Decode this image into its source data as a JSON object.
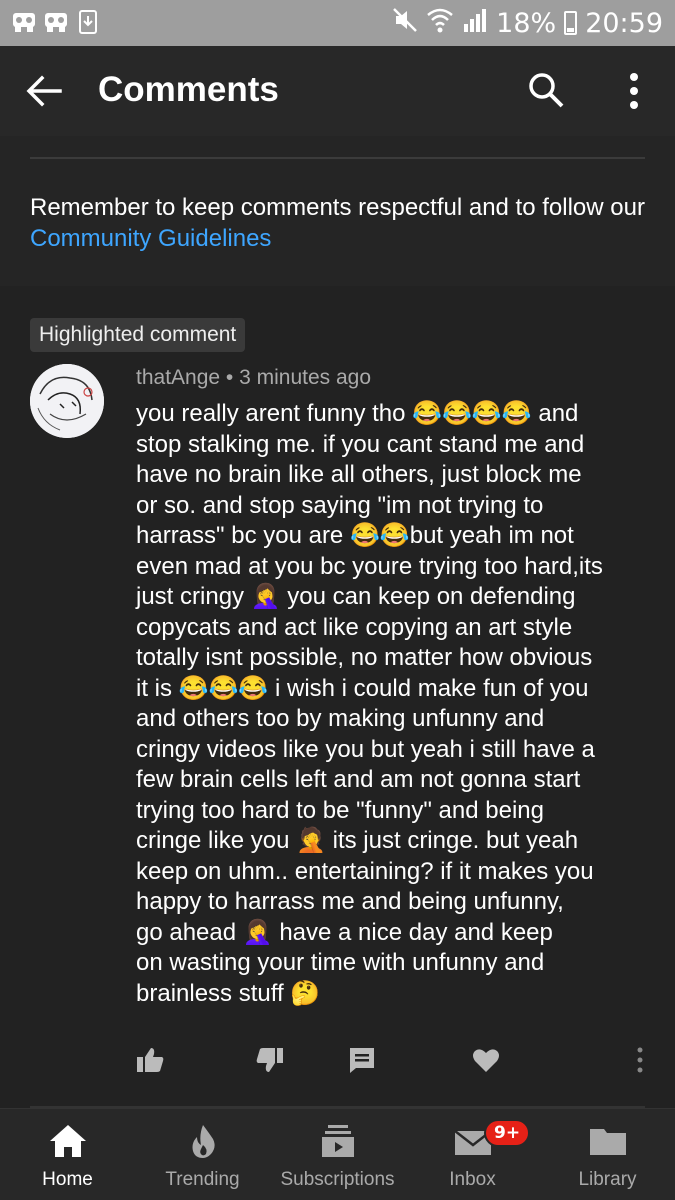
{
  "status_bar": {
    "battery": "18%",
    "time": "20:59",
    "icons": [
      "app-icon",
      "app-icon",
      "download-icon",
      "mute-icon",
      "wifi-icon",
      "signal-icon",
      "battery-icon"
    ]
  },
  "header": {
    "title": "Comments"
  },
  "reminder": {
    "text": "Remember to keep comments respectful and to follow our ",
    "link": "Community Guidelines"
  },
  "comment": {
    "badge": "Highlighted comment",
    "author": "thatAnge",
    "time": " • 3 minutes ago",
    "text": "you really arent funny tho 😂😂😂😂 and\nstop stalking me. if you cant stand me and\nhave no brain like all others, just block me\nor so. and stop saying \"im not trying to\nharrass\" bc you are 😂😂but yeah im not\neven mad at you bc youre trying too hard,its\njust cringy 🤦‍♀️ you can keep on defending\ncopycats and act like copying an art style\ntotally isnt possible, no matter how obvious\nit is 😂😂😂 i wish i could make fun of you\nand others too by making unfunny and\ncringy videos like you but yeah i still have a\nfew brain cells left and am not gonna start\ntrying too hard to be \"funny\"  and being\ncringe like you 🤦 its just cringe. but yeah\nkeep on uhm.. entertaining? if it makes you\nhappy to harrass me and being unfunny,\ngo ahead 🤦‍♀️ have a nice day and keep\non wasting your time with unfunny and\nbrainless stuff 🤔"
  },
  "nav": {
    "items": [
      {
        "label": "Home",
        "icon": "home-icon"
      },
      {
        "label": "Trending",
        "icon": "flame-icon"
      },
      {
        "label": "Subscriptions",
        "icon": "subscriptions-icon"
      },
      {
        "label": "Inbox",
        "icon": "inbox-icon",
        "badge": "9+"
      },
      {
        "label": "Library",
        "icon": "folder-icon"
      }
    ]
  },
  "colors": {
    "link": "#3ea6ff",
    "badge_red": "#e62117",
    "background": "#1f1f1f"
  }
}
